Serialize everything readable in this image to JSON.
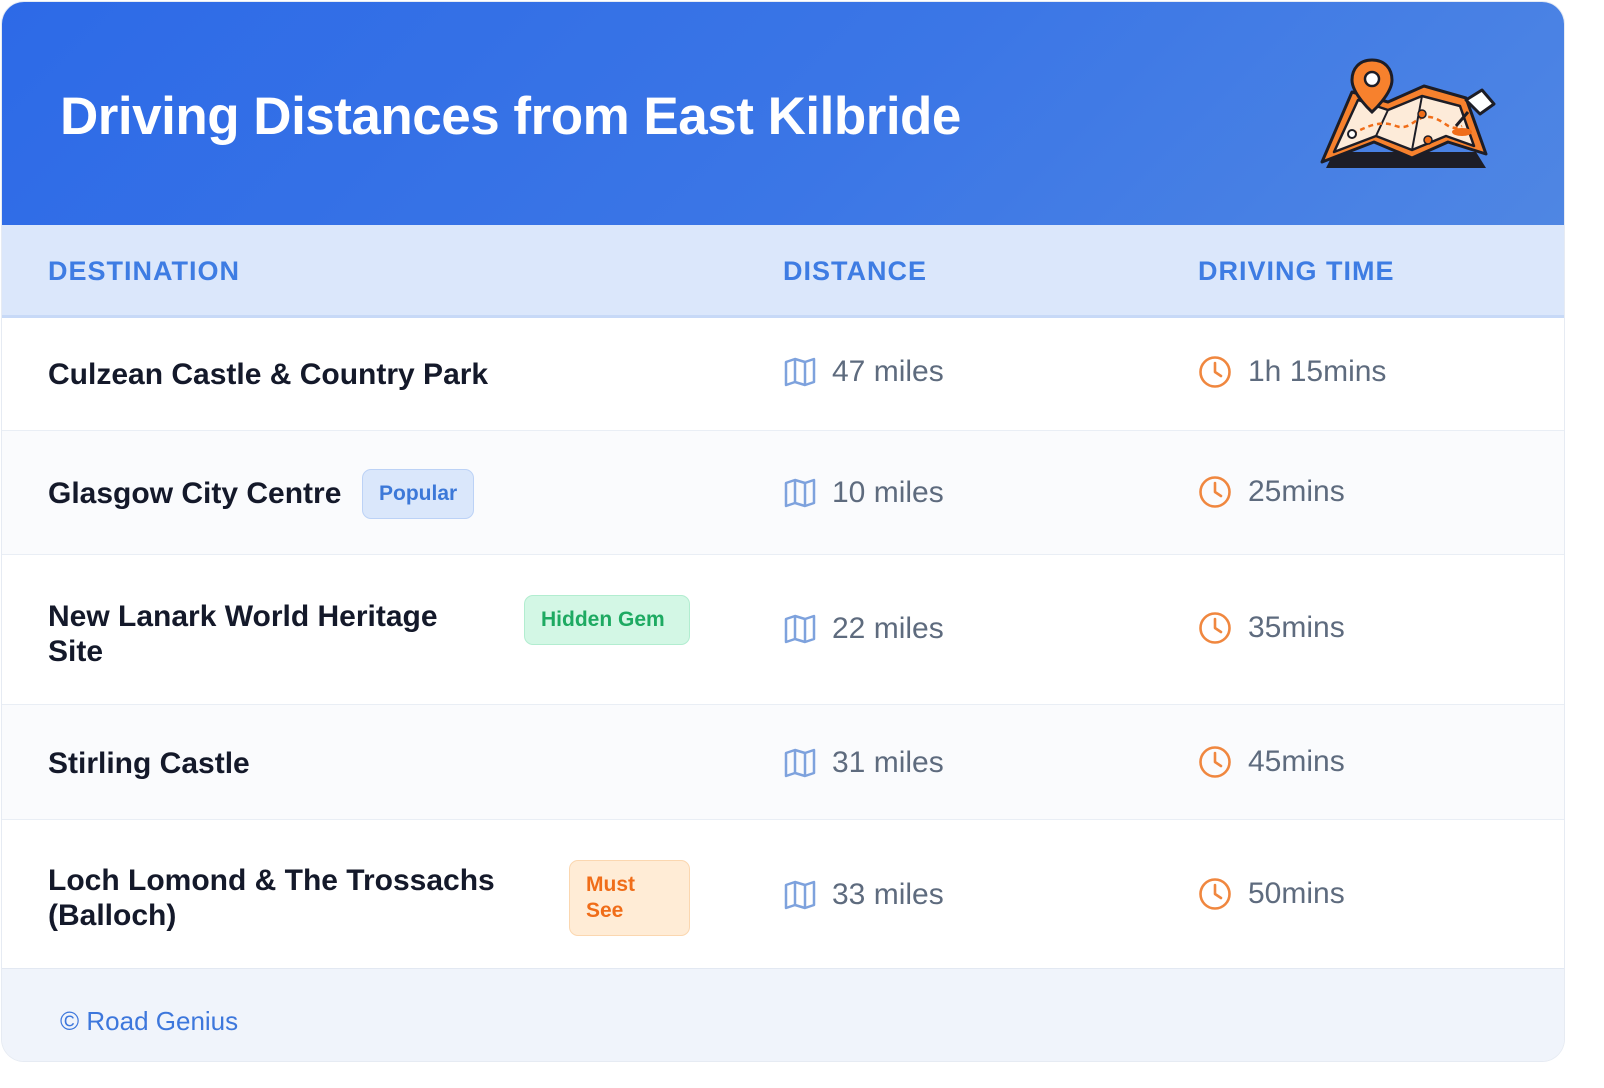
{
  "title": "Driving Distances from East Kilbride",
  "illustration": "map-with-location-pin-icon",
  "columns": {
    "destination": "DESTINATION",
    "distance": "DISTANCE",
    "time": "DRIVING TIME"
  },
  "rows": [
    {
      "destination": "Culzean Castle & Country Park",
      "badge": null,
      "distance": "47 miles",
      "time": "1h 15mins"
    },
    {
      "destination": "Glasgow City Centre",
      "badge": "Popular",
      "distance": "10 miles",
      "time": "25mins"
    },
    {
      "destination": "New Lanark World Heritage Site",
      "badge": "Hidden Gem",
      "distance": "22 miles",
      "time": "35mins"
    },
    {
      "destination": "Stirling Castle",
      "badge": null,
      "distance": "31 miles",
      "time": "45mins"
    },
    {
      "destination": "Loch Lomond & The Trossachs (Balloch)",
      "badge": "Must See",
      "distance": "33 miles",
      "time": "50mins"
    }
  ],
  "icons": {
    "distance": "map-icon",
    "time": "clock-icon"
  },
  "footer": "© Road Genius",
  "colors": {
    "header_bg": "#2d6ae7",
    "accent": "#3e7ce3",
    "badge_popular": "#3c78d8",
    "badge_hidden_gem": "#1eaa62",
    "badge_must_see": "#f06d19",
    "clock_orange": "#f0873f"
  }
}
